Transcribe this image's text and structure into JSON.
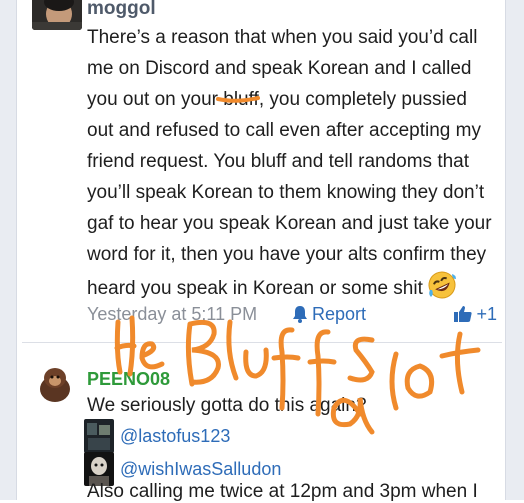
{
  "post1": {
    "username": "moggol",
    "body_lines": [
      "There’s a reason that when you said you’d call",
      "me on Discord and speak Korean and I called",
      "you out on your bluff, you completely pussied",
      "out and refused to call even after accepting my",
      "friend request. You bluff and tell randoms that",
      "you’ll speak Korean to them knowing they don’t",
      "gaf to hear you speak Korean and just take your",
      "word for it, then you have your alts confirm they",
      "heard you speak in Korean or some shit"
    ],
    "emoji_icon": "rolling-on-floor-laughing-emoji",
    "timestamp": "Yesterday at 5:11 PM",
    "report_label": "Report",
    "reaction_count": "+1",
    "reaction_icon": "thumbs-up-icon"
  },
  "post2": {
    "username": "PEENO08",
    "line1": "We seriously gotta do this again?",
    "mentions": [
      "@lastofus123",
      "@wishIwasSalludon"
    ],
    "line_last": "Also calling me twice at 12pm and 3pm when I"
  },
  "annotation": {
    "text": "He Bluffs alot",
    "color": "#f08a2c"
  }
}
